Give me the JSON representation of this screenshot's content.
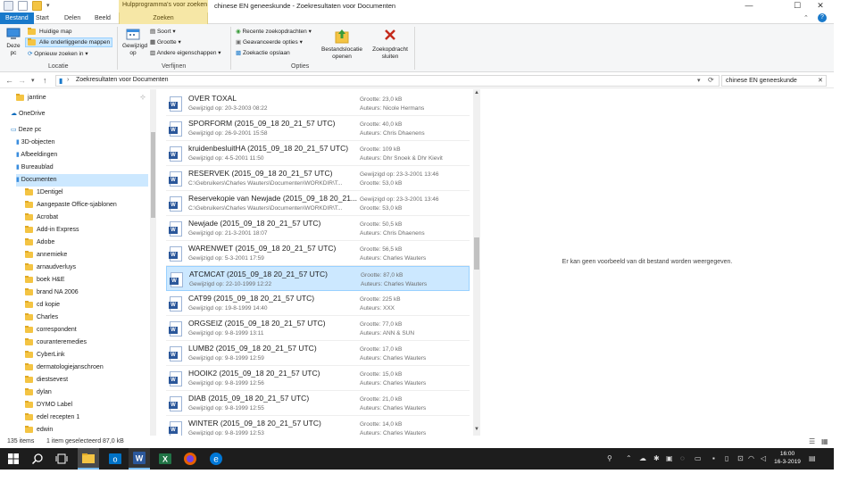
{
  "window": {
    "title": "chinese EN geneeskunde - Zoekresultaten voor Documenten",
    "context_tab_group": "Hulpprogramma's voor zoeken",
    "controls": {
      "minimize": "—",
      "maximize": "☐",
      "close": "✕"
    }
  },
  "tabs": [
    "Bestand",
    "Start",
    "Delen",
    "Beeld",
    "Zoeken"
  ],
  "ribbon": {
    "locatie": {
      "this_pc": "Deze pc",
      "current_folder": "Huidige map",
      "all_subfolders": "Alle onderliggende mappen",
      "search_again": "Opnieuw zoeken in",
      "label": "Locatie"
    },
    "verfijnen": {
      "modified": "Gewijzigd op",
      "sort": "Soort",
      "size": "Grootte",
      "other_props": "Andere eigenschappen",
      "label": "Verfijnen"
    },
    "opties": {
      "recent": "Recente zoekopdrachten",
      "advanced": "Geavanceerde opties",
      "save": "Zoekactie opslaan",
      "open_location": "Bestandslocatie openen",
      "close_search": "Zoekopdracht sluiten",
      "label": "Opties"
    }
  },
  "address": {
    "path": "Zoekresultaten voor Documenten",
    "search_value": "chinese EN geneeskunde"
  },
  "navpane": {
    "items": [
      {
        "label": "jantine",
        "type": "folder"
      },
      {
        "label": "OneDrive",
        "type": "onedrive"
      },
      {
        "label": "Deze pc",
        "type": "pc"
      },
      {
        "label": "3D-objecten",
        "type": "special"
      },
      {
        "label": "Afbeeldingen",
        "type": "special"
      },
      {
        "label": "Bureaublad",
        "type": "special"
      },
      {
        "label": "Documenten",
        "type": "special",
        "selected": true
      },
      {
        "label": "1Dentigel",
        "type": "folder"
      },
      {
        "label": "Aangepaste Office-sjablonen",
        "type": "folder"
      },
      {
        "label": "Acrobat",
        "type": "folder"
      },
      {
        "label": "Add-in Express",
        "type": "folder"
      },
      {
        "label": "Adobe",
        "type": "folder"
      },
      {
        "label": "annemieke",
        "type": "folder"
      },
      {
        "label": "arnaudverluys",
        "type": "folder"
      },
      {
        "label": "boek H&E",
        "type": "folder"
      },
      {
        "label": "brand NA 2006",
        "type": "folder"
      },
      {
        "label": "cd kopie",
        "type": "folder"
      },
      {
        "label": "Charles",
        "type": "folder"
      },
      {
        "label": "correspondent",
        "type": "folder"
      },
      {
        "label": "couranteremedies",
        "type": "folder"
      },
      {
        "label": "CyberLink",
        "type": "folder"
      },
      {
        "label": "dermatologiejanschroen",
        "type": "folder"
      },
      {
        "label": "diestsevest",
        "type": "folder"
      },
      {
        "label": "dylan",
        "type": "folder"
      },
      {
        "label": "DYMO Label",
        "type": "folder"
      },
      {
        "label": "edel recepten 1",
        "type": "folder"
      },
      {
        "label": "edwin",
        "type": "folder"
      }
    ]
  },
  "files": [
    {
      "name": "OVER TOXAL",
      "sub": "Gewijzigd op: 20-3-2003 08:22",
      "meta1": "Grootte: 23,0 kB",
      "meta2": "Auteurs: Nicole Hermans",
      "selected": false
    },
    {
      "name": "SPORFORM (2015_09_18 20_21_57 UTC)",
      "sub": "Gewijzigd op: 26-9-2001 15:58",
      "meta1": "Grootte: 40,0 kB",
      "meta2": "Auteurs: Chris Dhaenens",
      "selected": false
    },
    {
      "name": "kruidenbesluitHA (2015_09_18 20_21_57 UTC)",
      "sub": "Gewijzigd op: 4-5-2001 11:50",
      "meta1": "Grootte: 109 kB",
      "meta2": "Auteurs: Dhr Snoek & Dhr Kievit",
      "selected": false
    },
    {
      "name": "RESERVEK (2015_09_18 20_21_57 UTC)",
      "sub": "C:\\Gebruikers\\Charles Wauters\\Documenten\\WORKDIR\\T...",
      "meta1": "Gewijzigd op: 23-3-2001 13:46",
      "meta2": "Grootte: 53,0 kB",
      "selected": false
    },
    {
      "name": "Reservekopie van Newjade (2015_09_18 20_21...",
      "sub": "C:\\Gebruikers\\Charles Wauters\\Documenten\\WORKDIR\\T...",
      "meta1": "Gewijzigd op: 23-3-2001 13:46",
      "meta2": "Grootte: 53,0 kB",
      "selected": false
    },
    {
      "name": "Newjade (2015_09_18 20_21_57 UTC)",
      "sub": "Gewijzigd op: 21-3-2001 18:07",
      "meta1": "Grootte: 50,5 kB",
      "meta2": "Auteurs: Chris Dhaenens",
      "selected": false
    },
    {
      "name": "WARENWET (2015_09_18 20_21_57 UTC)",
      "sub": "Gewijzigd op: 5-3-2001 17:59",
      "meta1": "Grootte: 56,5 kB",
      "meta2": "Auteurs: Charles Wauters",
      "selected": false
    },
    {
      "name": "ATCMCAT (2015_09_18 20_21_57 UTC)",
      "sub": "Gewijzigd op: 22-10-1999 12:22",
      "meta1": "Grootte: 87,0 kB",
      "meta2": "Auteurs: Charles Wauters",
      "selected": true
    },
    {
      "name": "CAT99 (2015_09_18 20_21_57 UTC)",
      "sub": "Gewijzigd op: 19-8-1999 14:40",
      "meta1": "Grootte: 225 kB",
      "meta2": "Auteurs: XXX",
      "selected": false
    },
    {
      "name": "ORGSEIZ (2015_09_18 20_21_57 UTC)",
      "sub": "Gewijzigd op: 9-8-1999 13:11",
      "meta1": "Grootte: 77,0 kB",
      "meta2": "Auteurs: ANN & SUN",
      "selected": false
    },
    {
      "name": "LUMB2 (2015_09_18 20_21_57 UTC)",
      "sub": "Gewijzigd op: 9-8-1999 12:59",
      "meta1": "Grootte: 17,0 kB",
      "meta2": "Auteurs: Charles Wauters",
      "selected": false
    },
    {
      "name": "HOOIK2 (2015_09_18 20_21_57 UTC)",
      "sub": "Gewijzigd op: 9-8-1999 12:56",
      "meta1": "Grootte: 15,0 kB",
      "meta2": "Auteurs: Charles Wauters",
      "selected": false
    },
    {
      "name": "DIAB (2015_09_18 20_21_57 UTC)",
      "sub": "Gewijzigd op: 9-8-1999 12:55",
      "meta1": "Grootte: 21,0 kB",
      "meta2": "Auteurs: Charles Wauters",
      "selected": false
    },
    {
      "name": "WINTER (2015_09_18 20_21_57 UTC)",
      "sub": "Gewijzigd op: 9-8-1999 12:53",
      "meta1": "Grootte: 14,0 kB",
      "meta2": "Auteurs: Charles Wauters",
      "selected": false
    }
  ],
  "preview": {
    "message": "Er kan geen voorbeeld van dit bestand worden weergegeven."
  },
  "status": {
    "count": "135 items",
    "selection": "1 item geselecteerd  87,0 kB"
  },
  "taskbar": {
    "apps": [
      "windows-start-icon",
      "search-icon",
      "task-view-icon",
      "file-explorer-icon",
      "outlook-icon",
      "word-icon",
      "excel-icon",
      "firefox-icon",
      "edge-icon"
    ],
    "time": "16:00",
    "date": "16-3-2019"
  },
  "colors": {
    "accent": "#1979ca",
    "search_tab": "#f6e7a6",
    "selection": "#cce8ff",
    "word_blue": "#2b579a",
    "taskbar": "#1d1d1d"
  }
}
